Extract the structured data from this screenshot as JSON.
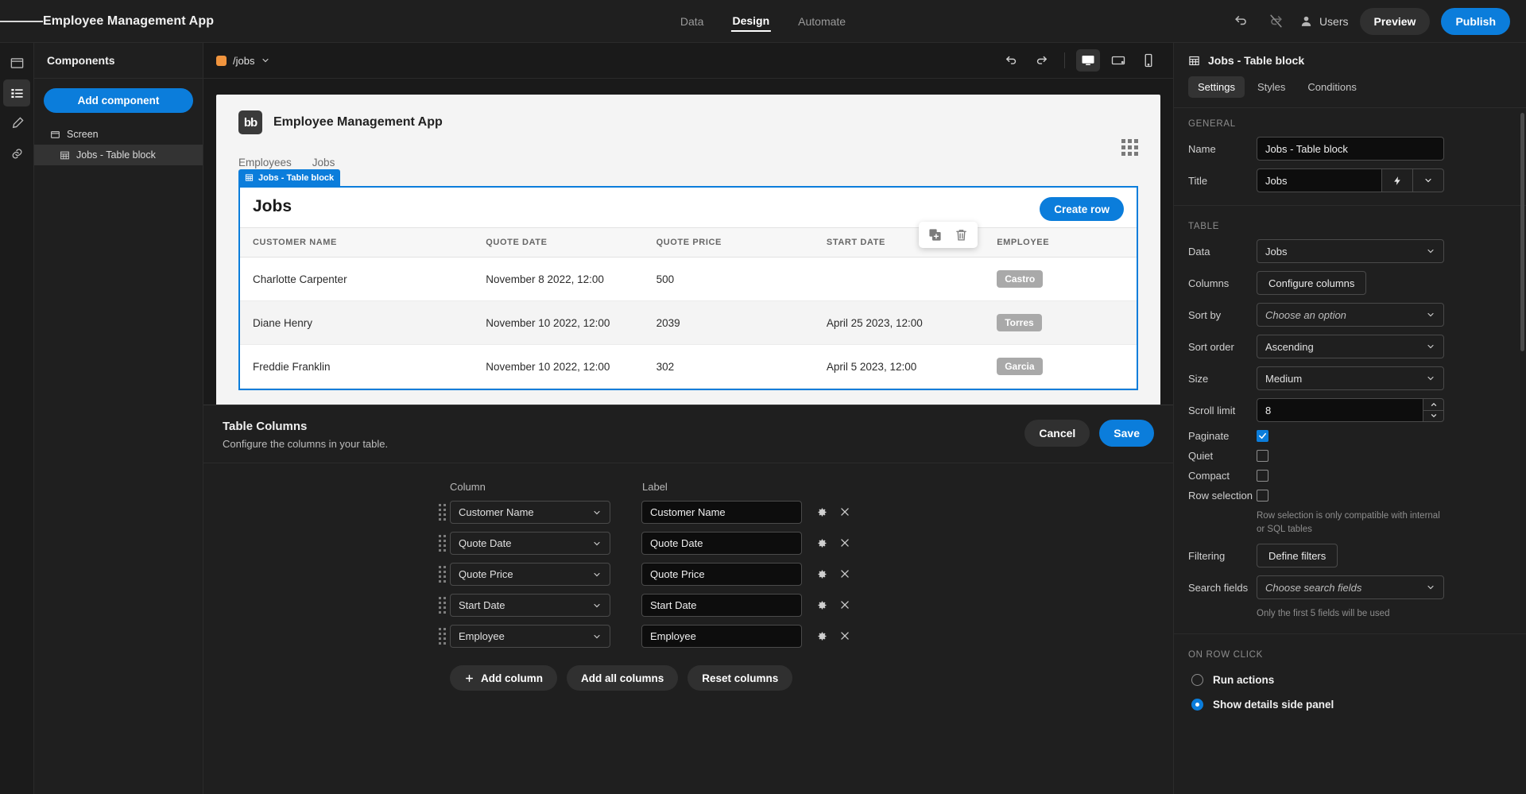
{
  "topbar": {
    "menu_icon": "hamburger-icon",
    "app_title": "Employee Management App",
    "nav": [
      {
        "label": "Data",
        "active": false
      },
      {
        "label": "Design",
        "active": true
      },
      {
        "label": "Automate",
        "active": false
      }
    ],
    "undo_icon": "undo-icon",
    "redo_icon": "redo-disabled-icon",
    "users_label": "Users",
    "preview_label": "Preview",
    "publish_label": "Publish"
  },
  "rail": [
    {
      "icon": "screen-icon",
      "active": false
    },
    {
      "icon": "components-list-icon",
      "active": true
    },
    {
      "icon": "theme-brush-icon",
      "active": false
    },
    {
      "icon": "link-icon",
      "active": false
    }
  ],
  "components": {
    "heading": "Components",
    "add_button": "Add component",
    "tree": [
      {
        "label": "Screen",
        "icon": "screen-icon",
        "selected": false
      },
      {
        "label": "Jobs - Table block",
        "icon": "table-icon",
        "selected": true
      }
    ]
  },
  "canvas_bar": {
    "route": "/jobs",
    "route_chevron": "chevron-down-icon",
    "undo_icon": "undo-icon",
    "redo_icon": "redo-icon",
    "devices": [
      {
        "name": "desktop-icon",
        "active": true
      },
      {
        "name": "tablet-icon",
        "active": false
      },
      {
        "name": "mobile-icon",
        "active": false
      }
    ]
  },
  "preview": {
    "logo_text": "bb",
    "app_name": "Employee Management App",
    "nav": [
      "Employees",
      "Jobs"
    ],
    "float_toolbar": [
      {
        "icon": "duplicate-icon"
      },
      {
        "icon": "delete-trash-icon"
      }
    ],
    "block_tag": "Jobs - Table block",
    "table": {
      "title": "Jobs",
      "create_row_label": "Create row",
      "headers": [
        "CUSTOMER NAME",
        "QUOTE DATE",
        "QUOTE PRICE",
        "START DATE",
        "EMPLOYEE"
      ],
      "rows": [
        {
          "customer_name": "Charlotte Carpenter",
          "quote_date": "November 8 2022, 12:00",
          "quote_price": "500",
          "start_date": "",
          "employee": "Castro"
        },
        {
          "customer_name": "Diane Henry",
          "quote_date": "November 10 2022, 12:00",
          "quote_price": "2039",
          "start_date": "April 25 2023, 12:00",
          "employee": "Torres"
        },
        {
          "customer_name": "Freddie Franklin",
          "quote_date": "November 10 2022, 12:00",
          "quote_price": "302",
          "start_date": "April 5 2023, 12:00",
          "employee": "Garcia"
        }
      ]
    }
  },
  "drawer": {
    "title": "Table Columns",
    "subtitle": "Configure the columns in your table.",
    "cancel_label": "Cancel",
    "save_label": "Save",
    "col_header_column": "Column",
    "col_header_label": "Label",
    "rows": [
      {
        "column": "Customer Name",
        "label": "Customer Name"
      },
      {
        "column": "Quote Date",
        "label": "Quote Date"
      },
      {
        "column": "Quote Price",
        "label": "Quote Price"
      },
      {
        "column": "Start Date",
        "label": "Start Date"
      },
      {
        "column": "Employee",
        "label": "Employee"
      }
    ],
    "add_column_label": "Add column",
    "add_all_columns_label": "Add all columns",
    "reset_columns_label": "Reset columns"
  },
  "right_panel": {
    "block_icon": "table-icon",
    "block_title": "Jobs - Table block",
    "tabs": [
      {
        "label": "Settings",
        "active": true
      },
      {
        "label": "Styles",
        "active": false
      },
      {
        "label": "Conditions",
        "active": false
      }
    ],
    "general_label": "GENERAL",
    "name_label": "Name",
    "name_value": "Jobs - Table block",
    "title_label": "Title",
    "title_value": "Jobs",
    "title_binding_icon": "lightning-bolt-icon",
    "title_chevron_icon": "chevron-down-icon",
    "table_label": "TABLE",
    "data_label": "Data",
    "data_value": "Jobs",
    "columns_label": "Columns",
    "configure_columns_label": "Configure columns",
    "sort_by_label": "Sort by",
    "sort_by_value": "Choose an option",
    "sort_order_label": "Sort order",
    "sort_order_value": "Ascending",
    "size_label": "Size",
    "size_value": "Medium",
    "scroll_limit_label": "Scroll limit",
    "scroll_limit_value": "8",
    "paginate_label": "Paginate",
    "paginate_checked": true,
    "quiet_label": "Quiet",
    "quiet_checked": false,
    "compact_label": "Compact",
    "compact_checked": false,
    "row_selection_label": "Row selection",
    "row_selection_checked": false,
    "row_selection_help": "Row selection is only compatible with internal or SQL tables",
    "filtering_label": "Filtering",
    "define_filters_label": "Define filters",
    "search_fields_label": "Search fields",
    "search_fields_value": "Choose search fields",
    "search_fields_help": "Only the first 5 fields will be used",
    "on_row_click_label": "ON ROW CLICK",
    "run_actions_label": "Run actions",
    "show_details_label": "Show details side panel",
    "selected_row_click": "show_details"
  },
  "colors": {
    "accent_blue": "#0b7ddb",
    "route_orange": "#f0943e",
    "panel_bg": "#1f1f1f",
    "chip_grey": "#a9a9a9"
  }
}
